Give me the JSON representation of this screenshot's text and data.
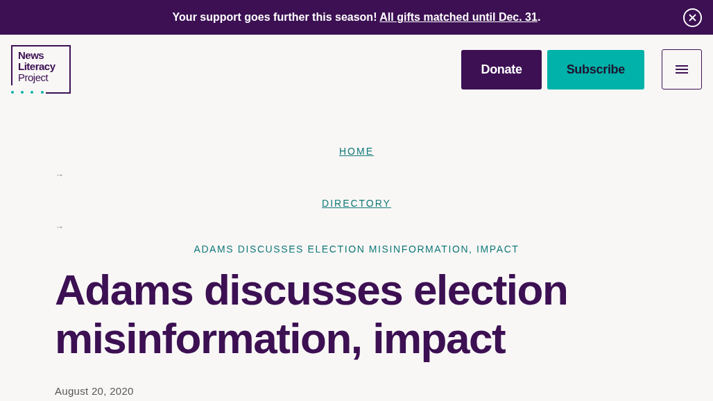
{
  "banner": {
    "text": "Your support goes further this season! ",
    "link": "All gifts matched until Dec. 31",
    "suffix": "."
  },
  "logo": {
    "lines": [
      "News",
      "Literacy",
      "Project"
    ]
  },
  "header_buttons": [
    {
      "label": "Donate",
      "kind": "primary"
    },
    {
      "label": "Subscribe",
      "kind": "secondary"
    }
  ],
  "breadcrumb": [
    {
      "label": "HOME",
      "kind": "link"
    },
    {
      "label": "→",
      "kind": "separator"
    },
    {
      "label": "DIRECTORY",
      "kind": "link"
    },
    {
      "label": "→",
      "kind": "separator"
    },
    {
      "label": "ADAMS DISCUSSES ELECTION MISINFORMATION, IMPACT",
      "kind": "current"
    }
  ],
  "article": {
    "title": "Adams discusses election misinformation, impact",
    "date": "August 20, 2020"
  }
}
